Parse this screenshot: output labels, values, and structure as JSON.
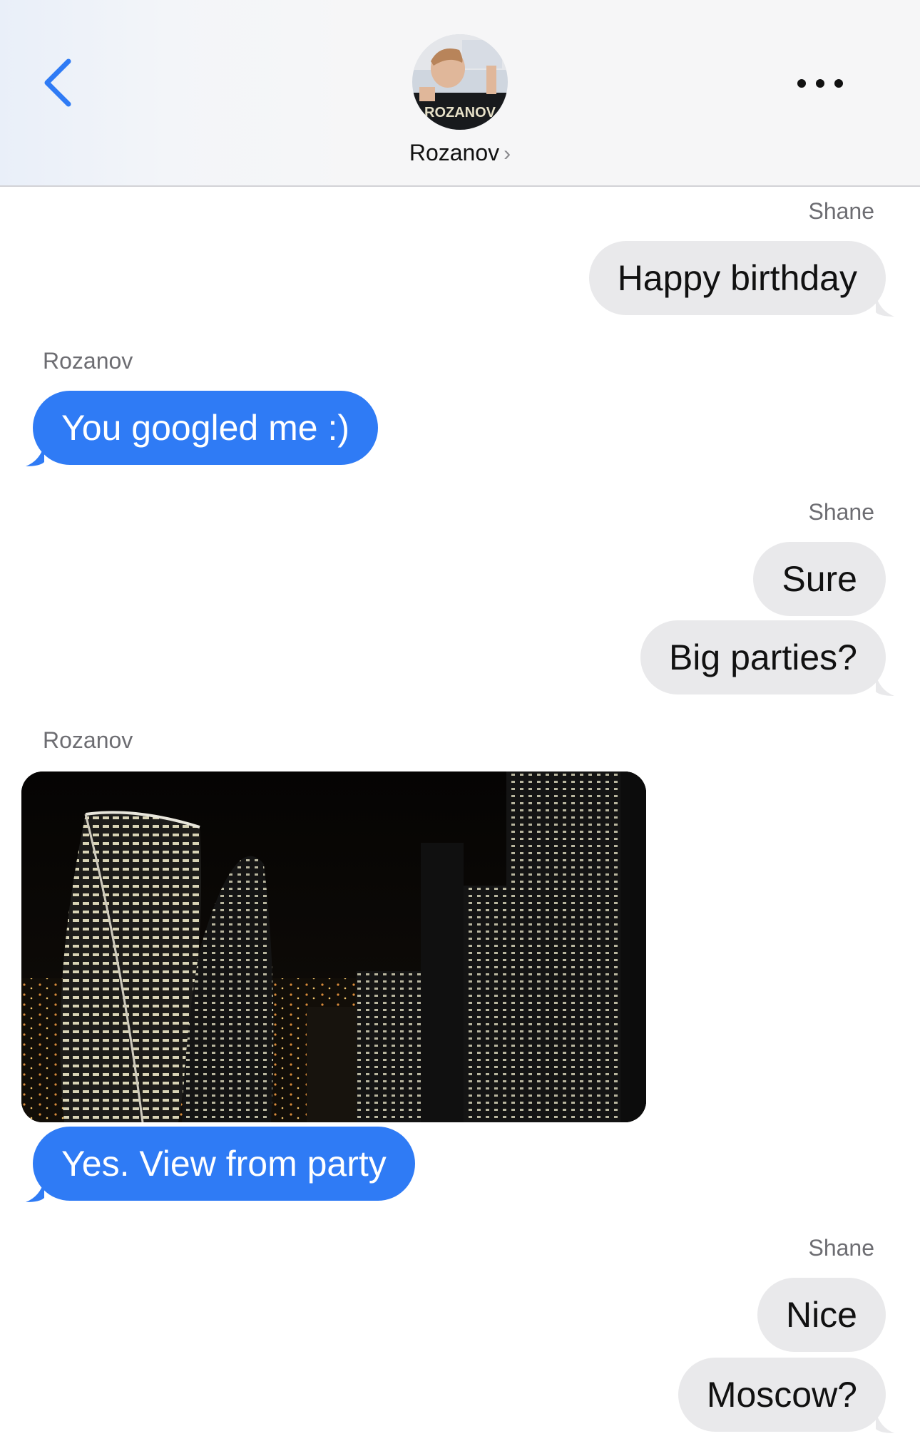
{
  "header": {
    "contact_name": "Rozanov",
    "chevron": "›",
    "avatar_text": "ROZANOV",
    "icons": {
      "back": "chevron-left-icon",
      "more": "ellipsis-icon"
    }
  },
  "messages": [
    {
      "sender": "Shane",
      "text": "Happy birthday"
    },
    {
      "sender": "Rozanov",
      "text": "You googled me :)"
    },
    {
      "sender": "Shane",
      "text": "Sure"
    },
    {
      "text": "Big parties?"
    },
    {
      "sender": "Rozanov",
      "attachment": "night-city-skyline-photo"
    },
    {
      "text": "Yes. View from party"
    },
    {
      "sender": "Shane",
      "text": "Nice"
    },
    {
      "text": "Moscow?"
    }
  ],
  "colors": {
    "incoming_bubble": "#2f7bf5",
    "outgoing_bubble": "#e9e9eb",
    "accent": "#2f7bf5"
  }
}
